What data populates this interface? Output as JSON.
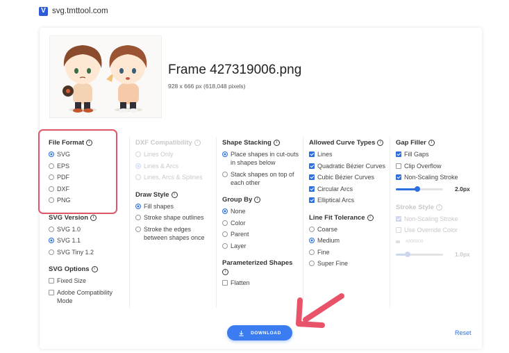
{
  "site": {
    "url": "svg.tmttool.com"
  },
  "file": {
    "name": "Frame 427319006.png",
    "info": "928 x 666 px (618,048 pixels)"
  },
  "file_format": {
    "title": "File Format",
    "options": [
      "SVG",
      "EPS",
      "PDF",
      "DXF",
      "PNG"
    ],
    "selected": "SVG"
  },
  "svg_version": {
    "title": "SVG Version",
    "options": [
      "SVG 1.0",
      "SVG 1.1",
      "SVG Tiny 1.2"
    ],
    "selected": "SVG 1.1"
  },
  "svg_options": {
    "title": "SVG Options",
    "options": [
      "Fixed Size",
      "Adobe Compatibility Mode"
    ]
  },
  "dxf_compat": {
    "title": "DXF Compatibility",
    "options": [
      "Lines Only",
      "Lines & Arcs",
      "Lines, Arcs & Splines"
    ],
    "selected": "Lines & Arcs",
    "disabled": true
  },
  "draw_style": {
    "title": "Draw Style",
    "options": [
      "Fill shapes",
      "Stroke shape outlines",
      "Stroke the edges between shapes once"
    ],
    "selected": "Fill shapes"
  },
  "shape_stacking": {
    "title": "Shape Stacking",
    "options": [
      "Place shapes in cut-outs in shapes below",
      "Stack shapes on top of each other"
    ],
    "selected": "Place shapes in cut-outs in shapes below"
  },
  "group_by": {
    "title": "Group By",
    "options": [
      "None",
      "Color",
      "Parent",
      "Layer"
    ],
    "selected": "None"
  },
  "param_shapes": {
    "title": "Parameterized Shapes",
    "options": [
      "Flatten"
    ]
  },
  "curve_types": {
    "title": "Allowed Curve Types",
    "options": [
      "Lines",
      "Quadratic Bézier Curves",
      "Cubic Bézier Curves",
      "Circular Arcs",
      "Elliptical Arcs"
    ],
    "checked": [
      true,
      true,
      true,
      true,
      true
    ]
  },
  "line_fit": {
    "title": "Line Fit Tolerance",
    "options": [
      "Coarse",
      "Medium",
      "Fine",
      "Super Fine"
    ],
    "selected": "Medium"
  },
  "gap_filler": {
    "title": "Gap Filler",
    "options": [
      "Fill Gaps",
      "Clip Overflow",
      "Non-Scaling Stroke"
    ],
    "checked": [
      true,
      false,
      true
    ],
    "slider_value": "2.0px",
    "slider_fraction": 0.45
  },
  "stroke_style": {
    "title": "Stroke Style",
    "options": [
      "Non-Scaling Stroke",
      "Use Override Color"
    ],
    "checked": [
      true,
      false
    ],
    "color_value": "#000000",
    "slider_value": "1.0px",
    "slider_fraction": 0.25,
    "disabled": true
  },
  "actions": {
    "download": "DOWNLOAD",
    "reset": "Reset"
  },
  "colors": {
    "accent": "#2e6fe0",
    "button": "#3b7cf0",
    "highlight": "#e05666",
    "arrow": "#e9536a"
  },
  "icons": [
    "svg-logo-icon",
    "info-icon",
    "download-icon",
    "arrow-annotation-icon"
  ]
}
